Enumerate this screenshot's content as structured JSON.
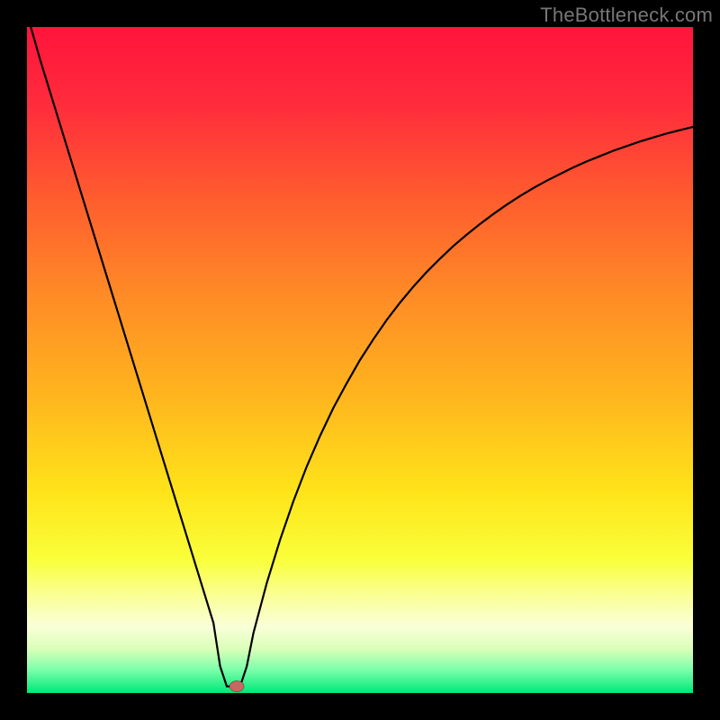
{
  "watermark": "TheBottleneck.com",
  "colors": {
    "frame": "#000000",
    "curve": "#000000",
    "marker_fill": "#c86860",
    "gradient_stops": [
      {
        "offset": 0.0,
        "color": "#ff143c"
      },
      {
        "offset": 0.12,
        "color": "#ff2d3c"
      },
      {
        "offset": 0.25,
        "color": "#ff5a2f"
      },
      {
        "offset": 0.4,
        "color": "#ff8a26"
      },
      {
        "offset": 0.55,
        "color": "#ffb41e"
      },
      {
        "offset": 0.7,
        "color": "#ffe41a"
      },
      {
        "offset": 0.8,
        "color": "#f9ff3a"
      },
      {
        "offset": 0.86,
        "color": "#faffa0"
      },
      {
        "offset": 0.9,
        "color": "#faffd8"
      },
      {
        "offset": 0.935,
        "color": "#d8ffb8"
      },
      {
        "offset": 0.965,
        "color": "#7bffaa"
      },
      {
        "offset": 1.0,
        "color": "#00e878"
      }
    ]
  },
  "chart_data": {
    "type": "line",
    "title": "",
    "xlabel": "",
    "ylabel": "",
    "xlim": [
      0,
      100
    ],
    "ylim": [
      0,
      100
    ],
    "grid": false,
    "legend": false,
    "x": [
      0,
      2,
      4,
      6,
      8,
      10,
      12,
      14,
      16,
      18,
      20,
      22,
      24,
      26,
      28,
      29,
      30,
      31,
      32,
      33,
      34,
      36,
      38,
      40,
      42,
      44,
      46,
      48,
      50,
      52,
      54,
      56,
      58,
      60,
      62,
      64,
      66,
      68,
      70,
      72,
      74,
      76,
      78,
      80,
      82,
      84,
      86,
      88,
      90,
      92,
      94,
      96,
      98,
      100
    ],
    "values": [
      102,
      95,
      88.5,
      82,
      75.5,
      69,
      62.5,
      56,
      49.5,
      43,
      36.5,
      30,
      23.5,
      17,
      10.5,
      4,
      1,
      1,
      1,
      4,
      9,
      16.5,
      23,
      28.8,
      34,
      38.6,
      42.8,
      46.5,
      50,
      53.1,
      56,
      58.6,
      61,
      63.2,
      65.2,
      67.1,
      68.8,
      70.4,
      71.9,
      73.3,
      74.6,
      75.8,
      76.9,
      77.9,
      78.9,
      79.8,
      80.6,
      81.4,
      82.1,
      82.8,
      83.4,
      84,
      84.5,
      85
    ],
    "marker": {
      "x": 31.5,
      "y": 1
    },
    "notes": "x and y are percentages of the plotting area; y=0 is bottom (green band), y=100 is top (red)."
  }
}
